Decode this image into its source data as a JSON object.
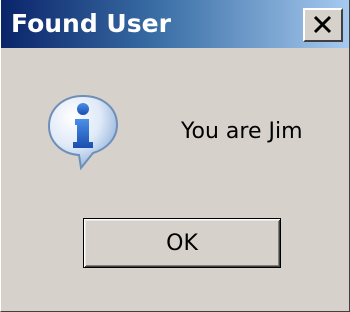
{
  "window": {
    "title": "Found User",
    "close_icon": "close-icon"
  },
  "dialog": {
    "icon": "info-icon",
    "message": "You are Jim",
    "ok_label": "OK"
  },
  "colors": {
    "dialog_bg": "#d6d2cb",
    "title_start": "#0a246a",
    "title_end": "#a6caf0",
    "title_text": "#ffffff",
    "icon_blue": "#2a6fd0"
  }
}
